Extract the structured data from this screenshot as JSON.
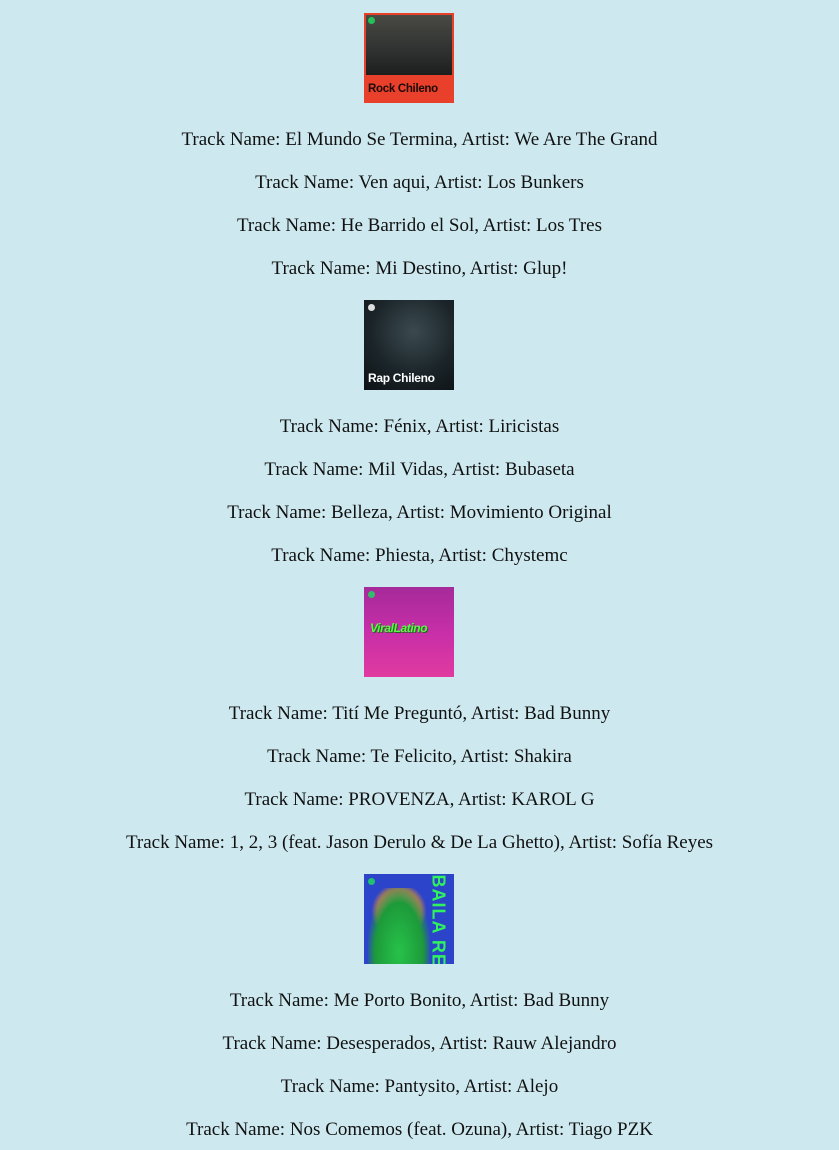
{
  "playlists": [
    {
      "cover_label": "Rock Chileno",
      "tracks": [
        {
          "text": "Track Name: El Mundo Se Termina, Artist: We Are The Grand"
        },
        {
          "text": "Track Name: Ven aqui, Artist: Los Bunkers"
        },
        {
          "text": "Track Name: He Barrido el Sol, Artist: Los Tres"
        },
        {
          "text": "Track Name: Mi Destino, Artist: Glup!"
        }
      ]
    },
    {
      "cover_label": "Rap Chileno",
      "tracks": [
        {
          "text": "Track Name: Fénix, Artist: Liricistas"
        },
        {
          "text": "Track Name: Mil Vidas, Artist: Bubaseta"
        },
        {
          "text": "Track Name: Belleza, Artist: Movimiento Original"
        },
        {
          "text": "Track Name: Phiesta, Artist: Chystemc"
        }
      ]
    },
    {
      "cover_label": "ViralLatino",
      "tracks": [
        {
          "text": "Track Name: Tití Me Preguntó, Artist: Bad Bunny"
        },
        {
          "text": "Track Name: Te Felicito, Artist: Shakira"
        },
        {
          "text": "Track Name: PROVENZA, Artist: KAROL G"
        },
        {
          "text": "Track Name: 1, 2, 3 (feat. Jason Derulo & De La Ghetto), Artist: Sofía Reyes"
        }
      ]
    },
    {
      "cover_label": "BAILA REGGAETON",
      "tracks": [
        {
          "text": "Track Name: Me Porto Bonito, Artist: Bad Bunny"
        },
        {
          "text": "Track Name: Desesperados, Artist: Rauw Alejandro"
        },
        {
          "text": "Track Name: Pantysito, Artist: Alejo"
        },
        {
          "text": "Track Name: Nos Comemos (feat. Ozuna), Artist: Tiago PZK"
        }
      ]
    }
  ],
  "colors": {
    "background": "#cde9ef",
    "rock_cover": "#e8402a",
    "rap_cover": "#141c20",
    "viral_cover": "#c72ea8",
    "baila_cover": "#2b44c9"
  }
}
